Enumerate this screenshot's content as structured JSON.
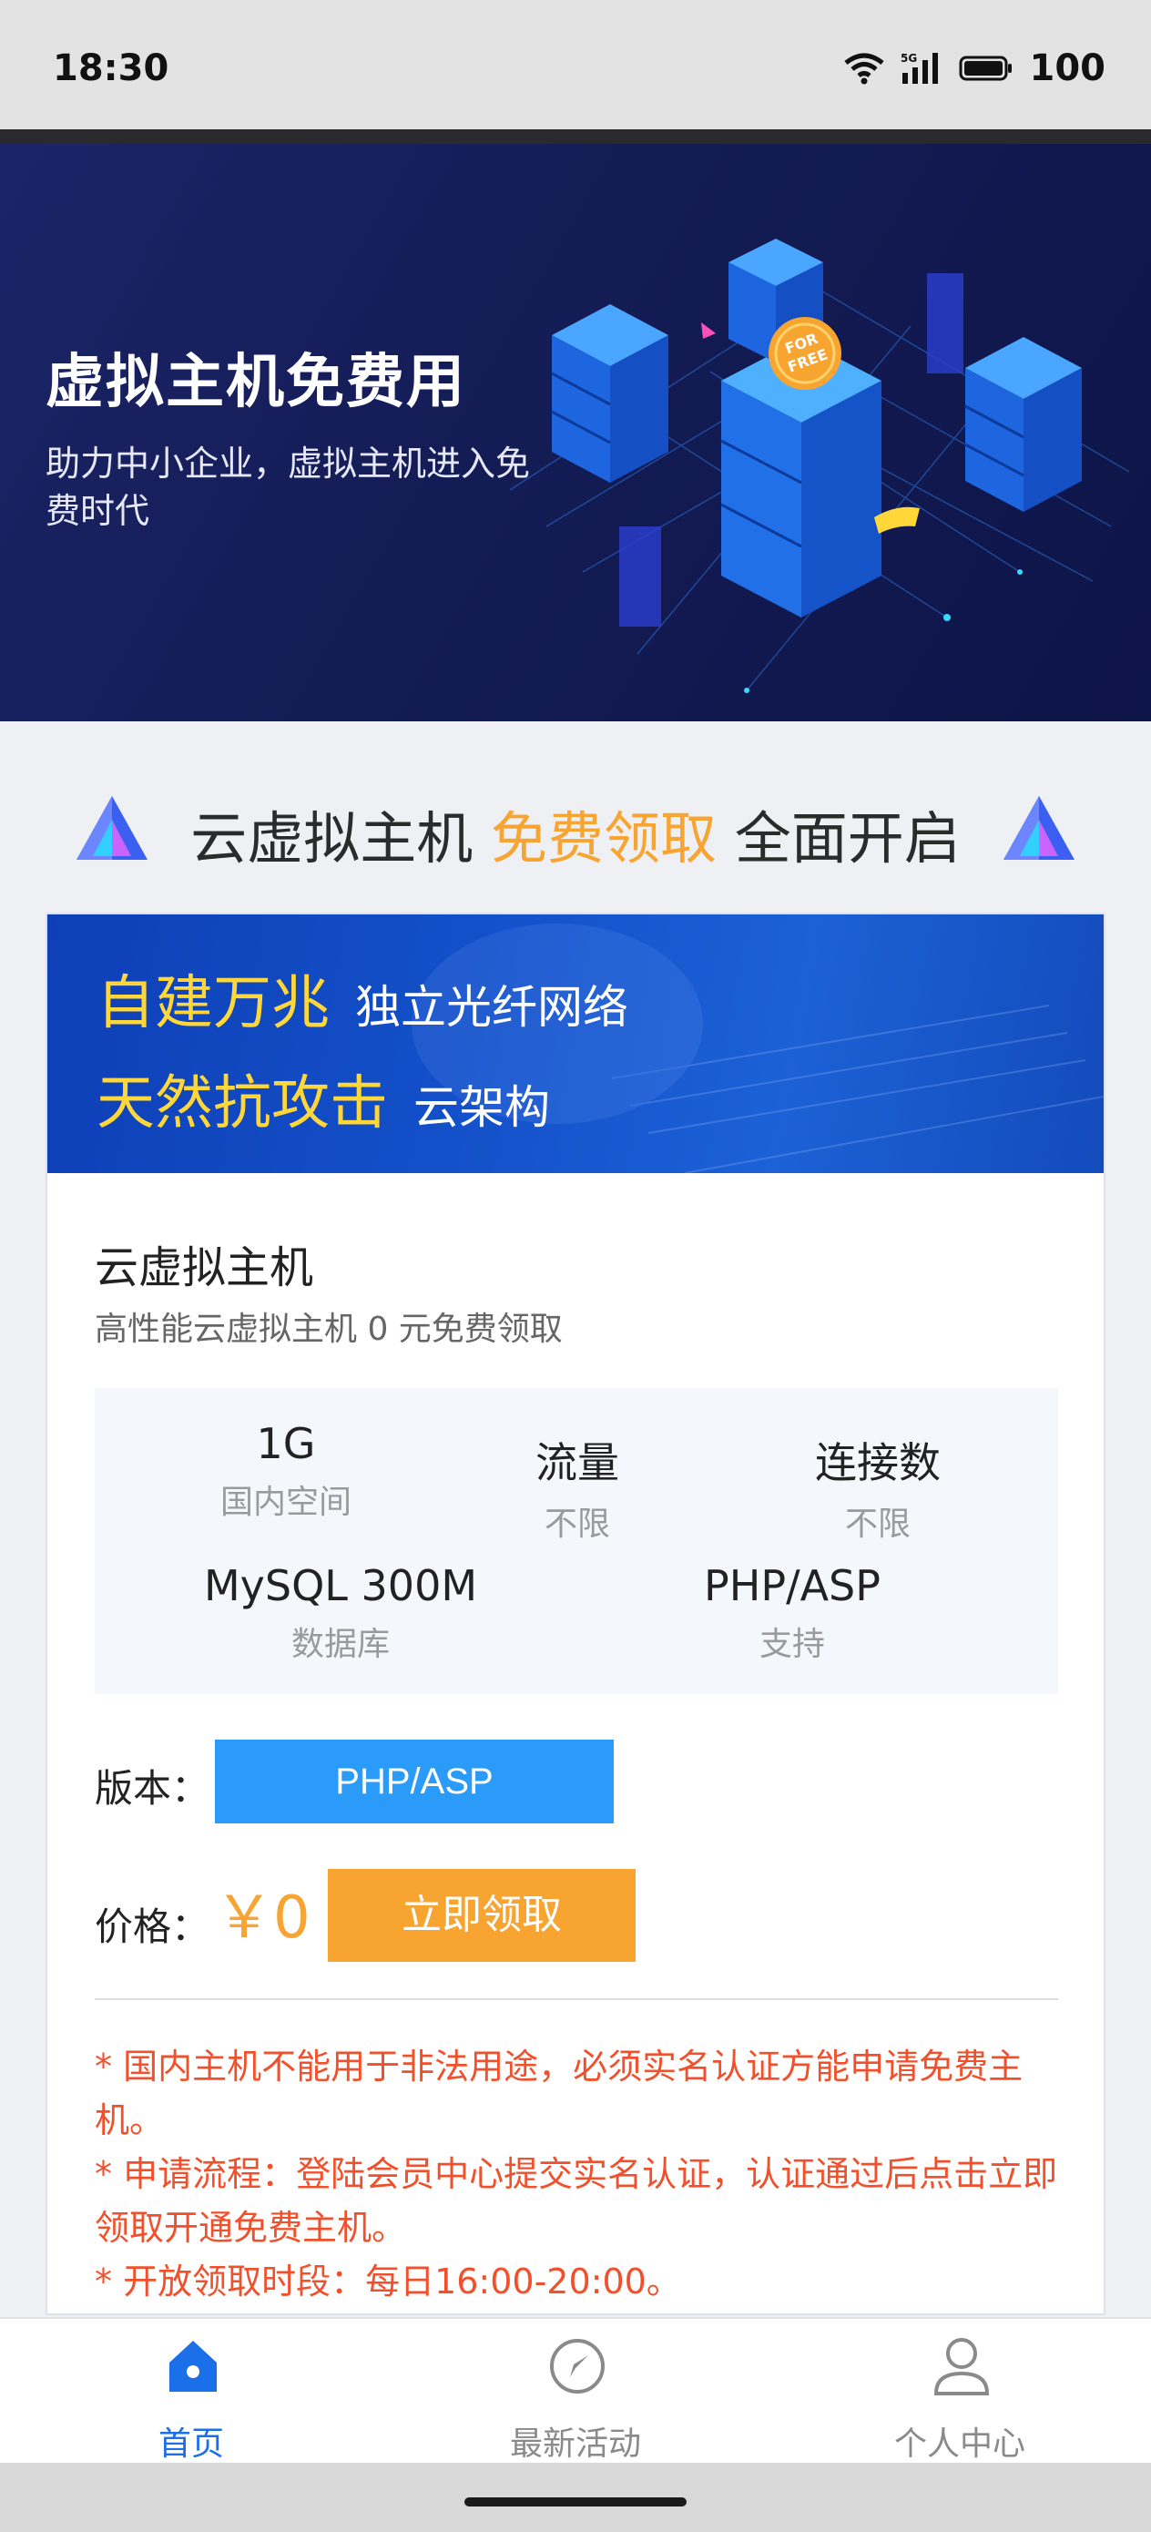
{
  "status_bar": {
    "time": "18:30",
    "battery": "100"
  },
  "banner": {
    "title": "虚拟主机免费用",
    "subtitle": "助力中小企业，虚拟主机进入免费时代",
    "badge_text": "FOR FREE"
  },
  "headline": {
    "part1": "云虚拟主机 ",
    "highlight": "免费领取",
    "part2": " 全面开启"
  },
  "card_banner": {
    "line1_big": "自建万兆",
    "line1_small": "独立光纤网络",
    "line2_big": "天然抗攻击",
    "line2_small": "云架构"
  },
  "product": {
    "title": "云虚拟主机",
    "subtitle": "高性能云虚拟主机 0 元免费领取",
    "specs": [
      {
        "value": "1G",
        "label": "国内空间"
      },
      {
        "value": "流量",
        "label": "不限"
      },
      {
        "value": "连接数",
        "label": "不限"
      },
      {
        "value": "MySQL 300M",
        "label": "数据库"
      },
      {
        "value": "PHP/ASP",
        "label": "支持"
      }
    ],
    "version_label": "版本：",
    "version_option": "PHP/ASP",
    "price_label": "价格：",
    "price": "￥0",
    "claim_button": "立即领取",
    "notes": [
      "* 国内主机不能用于非法用途，必须实名认证方能申请免费主机。",
      "* 申请流程：登陆会员中心提交实名认证，认证通过后点击立即领取开通免费主机。",
      "* 开放领取时段：每日16:00-20:00。"
    ]
  },
  "bottom_nav": [
    {
      "label": "首页",
      "icon": "home-icon",
      "active": true
    },
    {
      "label": "最新活动",
      "icon": "compass-icon",
      "active": false
    },
    {
      "label": "个人中心",
      "icon": "user-icon",
      "active": false
    }
  ],
  "colors": {
    "accent_blue": "#1b6fe8",
    "orange": "#f7a432",
    "notice_red": "#f1502c",
    "yellow": "#ffd739"
  }
}
